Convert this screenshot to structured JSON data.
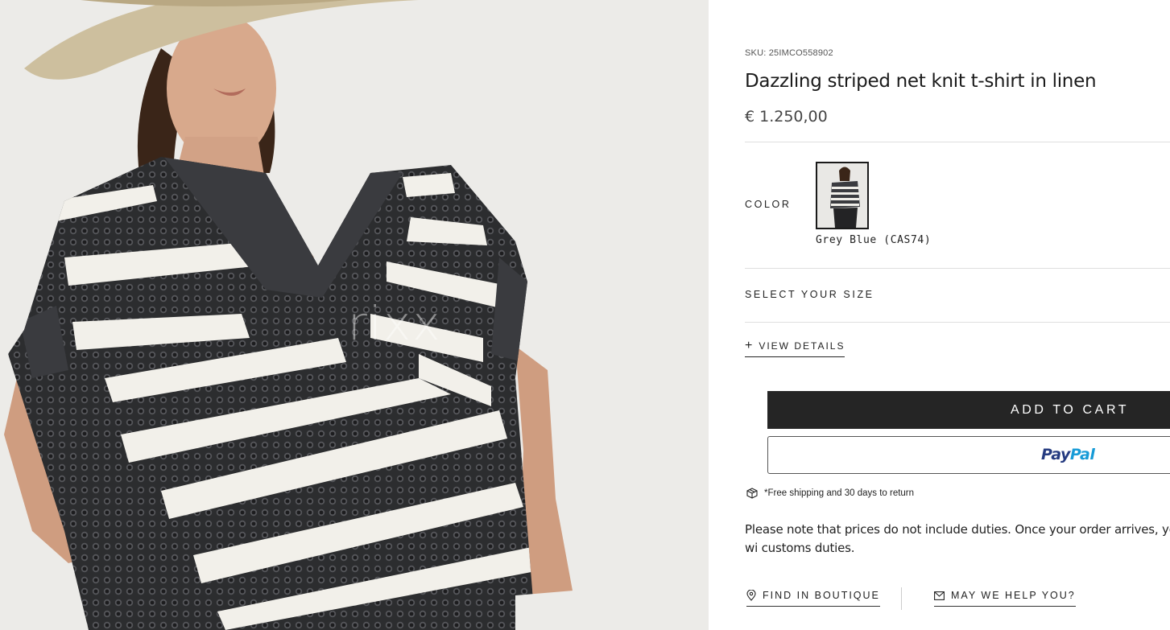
{
  "product": {
    "sku": "SKU: 25IMCO558902",
    "title": "Dazzling striped net knit t-shirt in linen",
    "price": "€ 1.250,00",
    "image_watermark": "rixx"
  },
  "color": {
    "label": "COLOR",
    "selected_name": "Grey Blue (CAS74)"
  },
  "size": {
    "label": "SELECT YOUR SIZE"
  },
  "details": {
    "view_label": "VIEW DETAILS",
    "icon": "plus-icon"
  },
  "actions": {
    "add_to_cart": "ADD TO CART",
    "paypal_pay": "Pay",
    "paypal_pal": "Pal"
  },
  "shipping": {
    "icon": "box-icon",
    "text": "*Free shipping and 30 days to return"
  },
  "notice": {
    "duties_text": "Please note that prices do not include duties. Once your order arrives, you wi customs duties."
  },
  "links": {
    "find_in_boutique": "FIND IN BOUTIQUE",
    "may_we_help": "MAY WE HELP YOU?"
  },
  "colors": {
    "accent_dark": "#252525",
    "paypal_blue": "#253b80",
    "paypal_light_blue": "#179bd7",
    "divider": "#dedede"
  }
}
